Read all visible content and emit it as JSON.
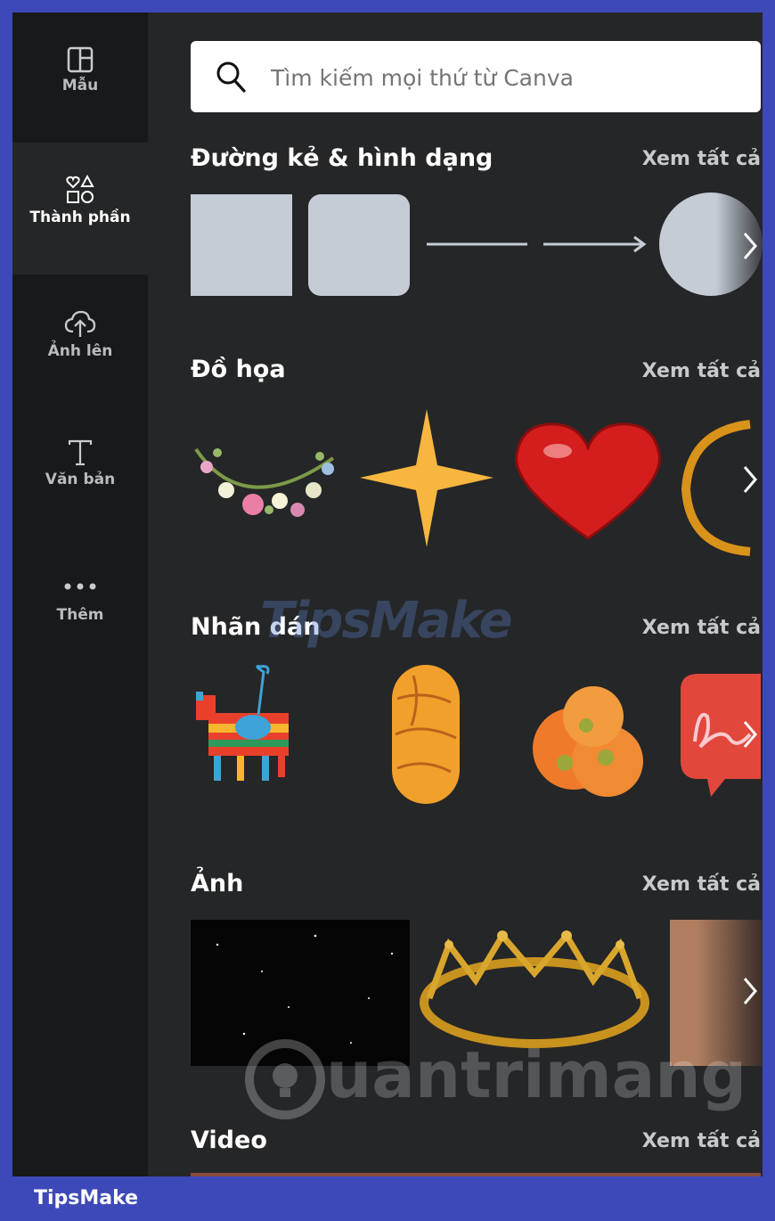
{
  "sidebar": {
    "items": [
      {
        "label": "Mẫu",
        "icon": "template-icon"
      },
      {
        "label": "Thành phần",
        "icon": "elements-icon"
      },
      {
        "label": "Ảnh lên",
        "icon": "upload-cloud-icon"
      },
      {
        "label": "Văn bản",
        "icon": "text-icon"
      },
      {
        "label": "Thêm",
        "icon": "more-dots-icon"
      }
    ],
    "active_index": 1
  },
  "search": {
    "placeholder": "Tìm kiếm mọi thứ từ Canva"
  },
  "sections": [
    {
      "title": "Đường kẻ & hình dạng",
      "see_all": "Xem tất cả"
    },
    {
      "title": "Đồ họa",
      "see_all": "Xem tất cả"
    },
    {
      "title": "Nhãn dán",
      "see_all": "Xem tất cả"
    },
    {
      "title": "Ảnh",
      "see_all": "Xem tất cả"
    },
    {
      "title": "Video",
      "see_all": "Xem tất cả"
    }
  ],
  "watermarks": {
    "tipsmake": "TipsMake",
    "quantrimang": "uantrimang"
  },
  "footer": {
    "label": "TipsMake"
  },
  "colors": {
    "frame": "#3d49b9",
    "panel": "#252627",
    "rail": "#18191b",
    "shape_fill": "#c5ccd6"
  }
}
